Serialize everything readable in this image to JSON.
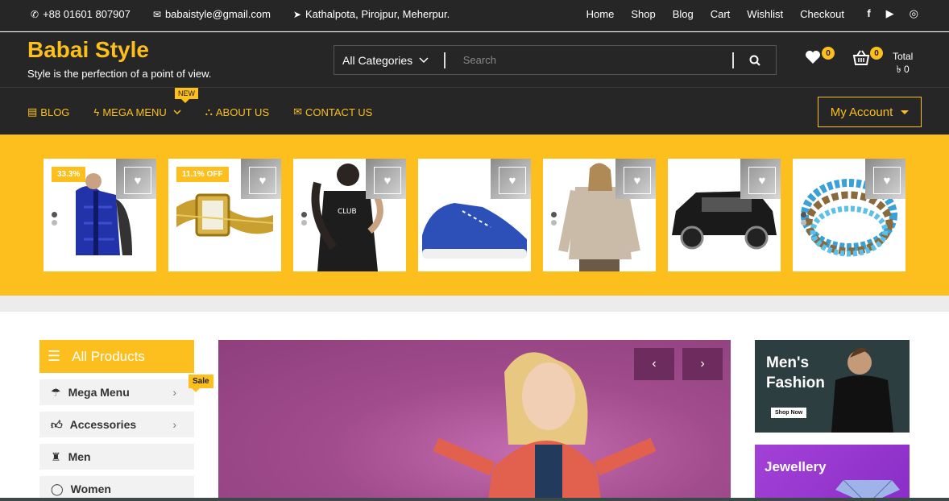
{
  "topbar": {
    "phone": "+88 01601 807907",
    "email": "babaistyle@gmail.com",
    "address": "Kathalpota, Pirojpur, Meherpur.",
    "links": [
      "Home",
      "Shop",
      "Blog",
      "Cart",
      "Wishlist",
      "Checkout"
    ],
    "social_icons": [
      "facebook-icon",
      "youtube-icon",
      "instagram-icon"
    ]
  },
  "header": {
    "title": "Babai Style",
    "tagline": "Style is the perfection of a point of view.",
    "category_label": "All Categories",
    "search_placeholder": "Search",
    "wishlist_count": "0",
    "cart_count": "0",
    "total_label": "Total",
    "total_value": "৳ 0"
  },
  "nav": {
    "items": [
      "BLOG",
      "MEGA MENU",
      "ABOUT US",
      "CONTACT US"
    ],
    "new_tag": "NEW",
    "account_label": "My Account"
  },
  "products": [
    {
      "discount": "33.3%",
      "name": "blue-vest"
    },
    {
      "discount": "11.1% OFF",
      "name": "gold-watch"
    },
    {
      "discount": "",
      "name": "black-dress"
    },
    {
      "discount": "",
      "name": "blue-sneaker"
    },
    {
      "discount": "",
      "name": "beige-sweater"
    },
    {
      "discount": "",
      "name": "black-suv"
    },
    {
      "discount": "",
      "name": "beaded-bracelet"
    }
  ],
  "sidebar": {
    "heading": "All Products",
    "sale_tag": "Sale",
    "items": [
      "Mega Menu",
      "Accessories",
      "Men",
      "Women"
    ]
  },
  "banners": {
    "men_line1": "Men's",
    "men_line2": "Fashion",
    "shop_now": "Shop Now",
    "jewellery": "Jewellery"
  },
  "colors": {
    "accent": "#fcbf1e",
    "dark": "#262626",
    "hero": "#a14c8d"
  }
}
